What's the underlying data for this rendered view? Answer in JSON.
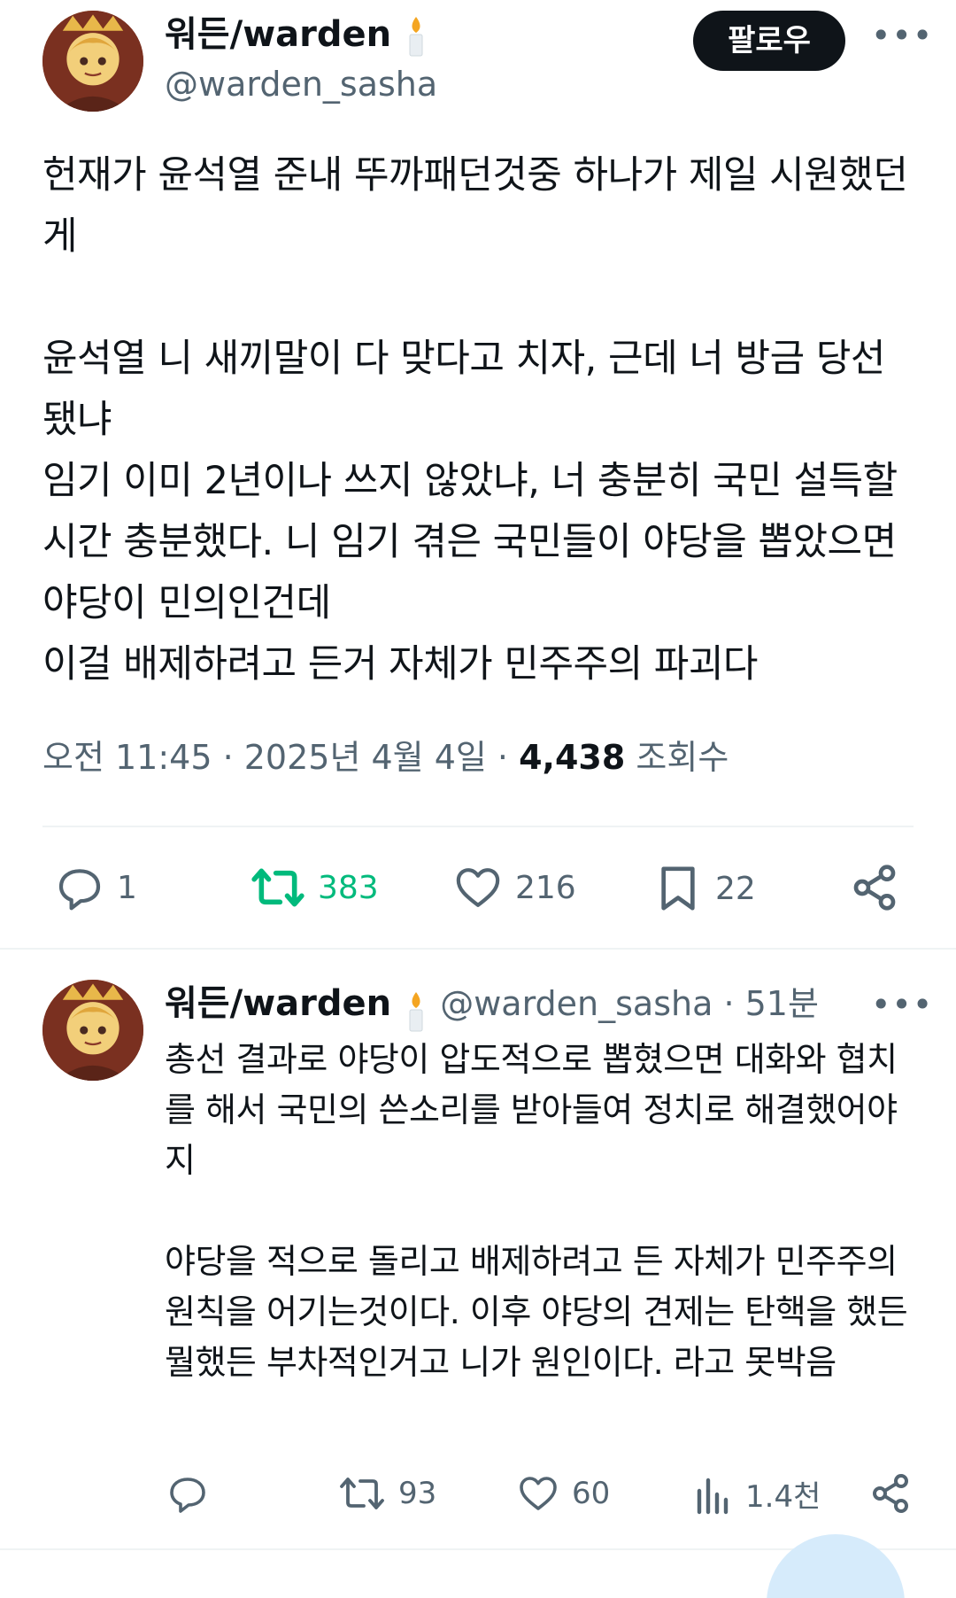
{
  "main_tweet": {
    "author_name": "워든/warden",
    "author_handle": "@warden_sasha",
    "follow_label": "팔로우",
    "more_label": "•••",
    "text": "헌재가 윤석열 준내 뚜까패던것중 하나가 제일 시원했던게\n\n윤석열 니 새끼말이 다 맞다고 치자, 근데 너 방금 당선됐냐\n임기 이미 2년이나 쓰지 않았냐, 너 충분히 국민 설득할 시간 충분했다. 니 임기 겪은 국민들이 야당을 뽑았으면 야당이 민의인건데\n이걸 배제하려고 든거 자체가 민주주의 파괴다",
    "timestamp": "오전 11:45 · 2025년 4월 4일 ·",
    "views_count": "4,438",
    "views_label": "조회수",
    "stats": {
      "replies": "1",
      "retweets": "383",
      "likes": "216",
      "bookmarks": "22"
    }
  },
  "reply_tweet": {
    "author_name": "워든/warden",
    "author_handle": "@warden_sasha · 51분",
    "more_label": "•••",
    "text": "총선 결과로 야당이 압도적으로 뽑혔으면 대화와 협치를 해서 국민의 쓴소리를 받아들여 정치로 해결했어야지\n\n야당을 적으로 돌리고 배제하려고 든 자체가 민주주의 원칙을 어기는것이다. 이후 야당의 견제는 탄핵을 했든 뭘했든 부차적인거고 니가 원인이다. 라고 못박음",
    "stats": {
      "retweets": "93",
      "likes": "60",
      "views": "1.4천"
    }
  },
  "colors": {
    "text_primary": "#0f1419",
    "text_secondary": "#536471",
    "retweet_active": "#00ba7c",
    "divider": "#eff3f4"
  },
  "icons": [
    "candle-icon",
    "reply-icon",
    "retweet-icon",
    "like-icon",
    "bookmark-icon",
    "share-icon",
    "views-icon"
  ]
}
